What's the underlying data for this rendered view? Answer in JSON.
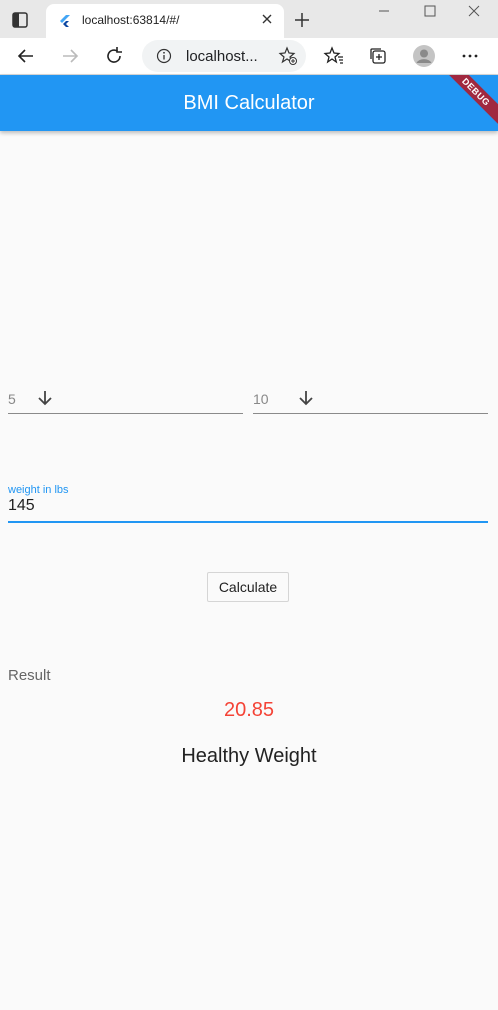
{
  "browser": {
    "tab_title": "localhost:63814/#/",
    "address": "localhost..."
  },
  "app": {
    "title": "BMI Calculator",
    "debug_banner": "DEBUG",
    "accent_color": "#2196f3"
  },
  "height": {
    "feet_value": "5",
    "inches_value": "10"
  },
  "weight": {
    "label": "weight in lbs",
    "value": "145"
  },
  "calculate_label": "Calculate",
  "result": {
    "label": "Result",
    "bmi": "20.85",
    "category": "Healthy Weight",
    "bmi_color": "#f44336"
  }
}
